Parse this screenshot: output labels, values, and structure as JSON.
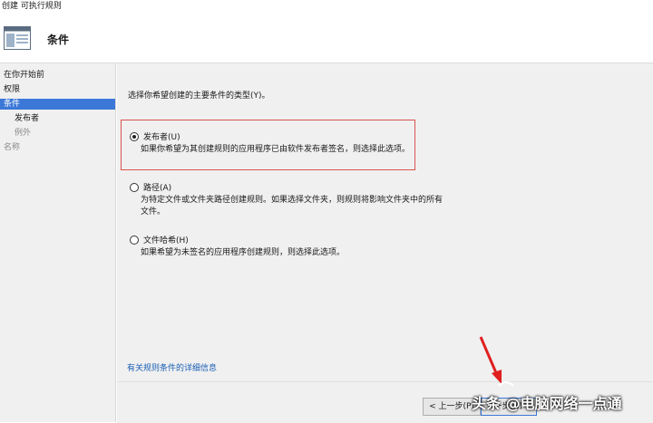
{
  "window": {
    "title": "创建 可执行规则"
  },
  "header": {
    "title": "条件",
    "icon": "wizard-page-icon"
  },
  "sidebar": {
    "items": [
      {
        "label": "在你开始前",
        "state": "normal"
      },
      {
        "label": "权限",
        "state": "normal"
      },
      {
        "label": "条件",
        "state": "active"
      },
      {
        "label": "发布者",
        "state": "normal"
      },
      {
        "label": "例外",
        "state": "disabled"
      },
      {
        "label": "名称",
        "state": "disabled"
      }
    ]
  },
  "main": {
    "prompt": "选择你希望创建的主要条件的类型(Y)。",
    "options": [
      {
        "label": "发布者(U)",
        "desc": "如果你希望为其创建规则的应用程序已由软件发布者签名，则选择此选项。",
        "checked": true
      },
      {
        "label": "路径(A)",
        "desc": "为特定文件或文件夹路径创建规则。如果选择文件夹，则规则将影响文件夹中的所有文件。",
        "checked": false
      },
      {
        "label": "文件哈希(H)",
        "desc": "如果希望为未签名的应用程序创建规则，则选择此选项。",
        "checked": false
      }
    ],
    "link": "有关规则条件的详细信息"
  },
  "footer": {
    "back_label": "< 上一步(P)",
    "next_label": "下一步(N) >"
  },
  "watermark": {
    "text": "头条 @电脑网络一点通"
  },
  "colors": {
    "highlight_border": "#d9534f",
    "active_nav": "#3c78d8",
    "link": "#1a5fb4",
    "arrow": "#e02020"
  }
}
